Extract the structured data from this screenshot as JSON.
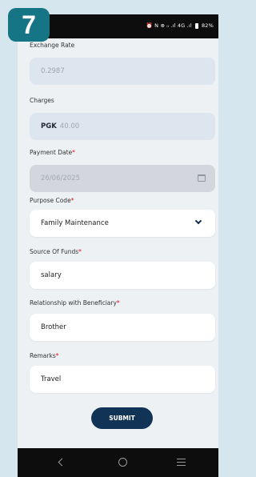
{
  "step_badge": "7",
  "status_bar": {
    "icons": [
      "alarm-icon",
      "nfc-icon",
      "wifi-icon",
      "signal-icon",
      "signal-icon"
    ],
    "indicators": "⏰ N ⊕ ᵢₗ .ıl 4G .ıl",
    "battery": "82%"
  },
  "form": {
    "exchange_rate": {
      "label": "Exchange Rate",
      "value": "0.2987"
    },
    "charges": {
      "label": "Charges",
      "currency": "PGK",
      "value": "40.00"
    },
    "payment_date": {
      "label": "Payment Date",
      "required_mark": "*",
      "value": "26/06/2025"
    },
    "purpose_code": {
      "label": "Purpose Code",
      "required_mark": "*",
      "value": "Family Maintenance"
    },
    "source_of_funds": {
      "label": "Source Of Funds",
      "required_mark": "*",
      "value": "salary"
    },
    "relationship": {
      "label": "Relationship with Beneficiary",
      "required_mark": "*",
      "value": "Brother"
    },
    "remarks": {
      "label": "Remarks",
      "required_mark": "*",
      "value": "Travel"
    },
    "submit_label": "SUBMIT"
  },
  "colors": {
    "badge": "#167585",
    "submit_button": "#113356",
    "required": "#d11111",
    "page_bg": "#eef1f4"
  }
}
